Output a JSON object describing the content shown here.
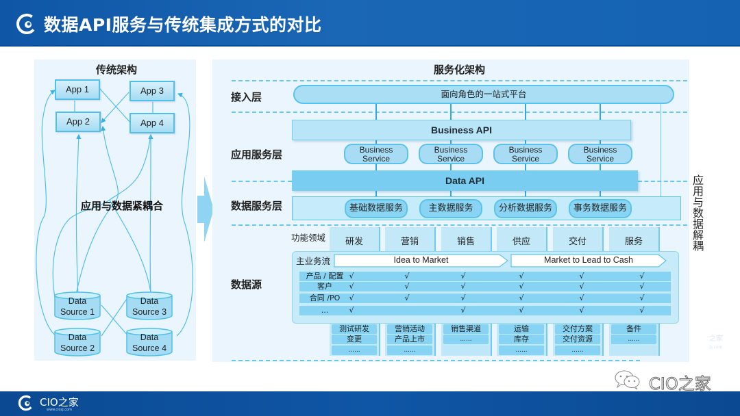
{
  "header": {
    "title": "数据API服务与传统集成方式的对比",
    "logo_icon": "cio-swirl-logo-icon"
  },
  "left_panel": {
    "title": "传统架构",
    "apps": [
      "App 1",
      "App 2",
      "App 3",
      "App 4"
    ],
    "data_sources": [
      {
        "line1": "Data",
        "line2": "Source 1"
      },
      {
        "line1": "Data",
        "line2": "Source 2"
      },
      {
        "line1": "Data",
        "line2": "Source 3"
      },
      {
        "line1": "Data",
        "line2": "Source 4"
      }
    ],
    "coupling_label": "应用与数据紧耦合"
  },
  "right_panel": {
    "title": "服务化架构",
    "layers": {
      "access": "接入层",
      "app_service": "应用服务层",
      "data_service": "数据服务层",
      "data_source": "数据源"
    },
    "platform": "面向角色的一站式平台",
    "business_api": "Business API",
    "business_services": [
      {
        "line1": "Business",
        "line2": "Service"
      },
      {
        "line1": "Business",
        "line2": "Service"
      },
      {
        "line1": "Business",
        "line2": "Service"
      },
      {
        "line1": "Business",
        "line2": "Service"
      }
    ],
    "data_api": "Data API",
    "data_services": [
      "基础数据服务",
      "主数据服务",
      "分析数据服务",
      "事务数据服务"
    ],
    "decouple_label": "应用与数据解耦",
    "function_domain_label": "功能领域",
    "function_domains": [
      "研发",
      "营销",
      "销售",
      "供应",
      "交付",
      "服务"
    ],
    "main_flow_label": "主业务流",
    "flows": [
      "Idea to Market",
      "Market to Lead to Cash"
    ],
    "matrix": {
      "check_symbol": "√",
      "rows": [
        {
          "label": "产品 / 配置",
          "checks": [
            true,
            true,
            true,
            true,
            true,
            true
          ]
        },
        {
          "label": "客户",
          "checks": [
            true,
            true,
            true,
            true,
            true,
            true
          ]
        },
        {
          "label": "合同 /PO",
          "checks": [
            true,
            true,
            true,
            true,
            true,
            true
          ]
        },
        {
          "label": "...",
          "checks": [
            true,
            false,
            true,
            true,
            true,
            true
          ]
        }
      ]
    },
    "sub_items": [
      [
        "测试研发",
        "变更",
        "......"
      ],
      [
        "营销活动",
        "产品上市",
        "......"
      ],
      [
        "销售渠道",
        "......",
        ""
      ],
      [
        "运输",
        "库存",
        "......"
      ],
      [
        "交付方案",
        "交付资源",
        "......"
      ],
      [
        "备件",
        "......",
        ""
      ]
    ]
  },
  "footer": {
    "brand": "CIO之家",
    "url": "www.ciozj.com"
  },
  "watermark": {
    "icon": "wechat-icon",
    "text": "CIO之家",
    "faint_line1": "之家",
    "faint_line2": "zj.com"
  }
}
